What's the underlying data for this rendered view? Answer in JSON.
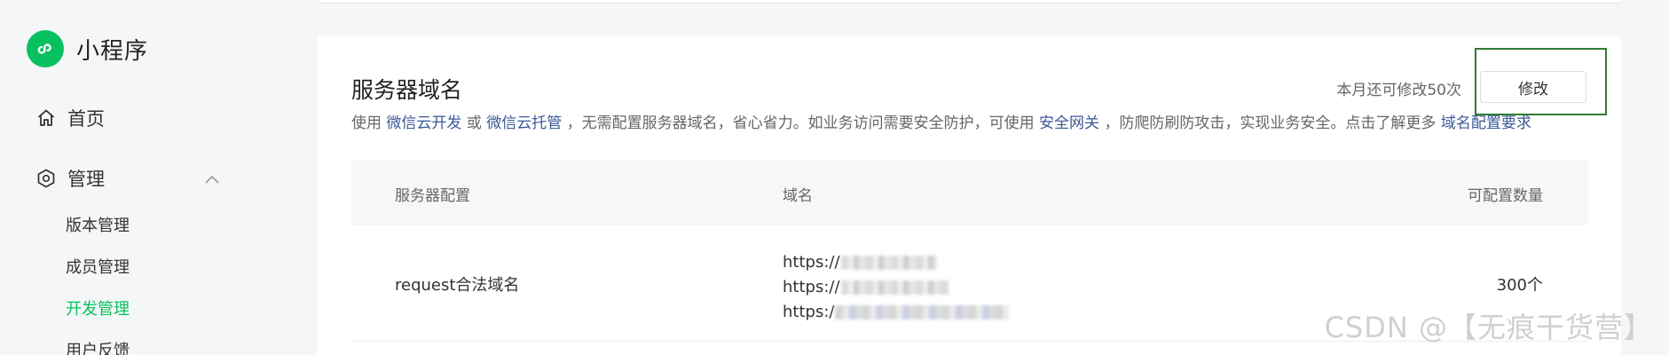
{
  "sidebar": {
    "brand": "小程序",
    "nav_home": "首页",
    "nav_manage": "管理",
    "sub_items": [
      "版本管理",
      "成员管理",
      "开发管理",
      "用户反馈"
    ],
    "active_item": "开发管理"
  },
  "card": {
    "title": "服务器域名",
    "quota_text": "本月还可修改50次",
    "edit_button": "修改",
    "desc": {
      "prefix": "使用",
      "link_cloud_dev": "微信云开发",
      "or": "或",
      "link_cloud_host": "微信云托管",
      "middle": "，无需配置服务器域名，省心省力。如业务访问需要安全防护，可使用",
      "link_security_gateway": "安全网关",
      "suffix": "，防爬防刷防攻击，实现业务安全。点击了解更多",
      "link_requirements": "域名配置要求"
    }
  },
  "table": {
    "headers": [
      "服务器配置",
      "域名",
      "可配置数量"
    ],
    "rows": [
      {
        "config": "request合法域名",
        "domains": [
          "https://",
          "https://",
          "https:/"
        ],
        "count": "300个"
      }
    ]
  },
  "watermark": "CSDN @【无痕干货营】",
  "colors": {
    "brand_green": "#07c160",
    "link_blue": "#3b5998",
    "highlight_border": "#2e7d32"
  }
}
